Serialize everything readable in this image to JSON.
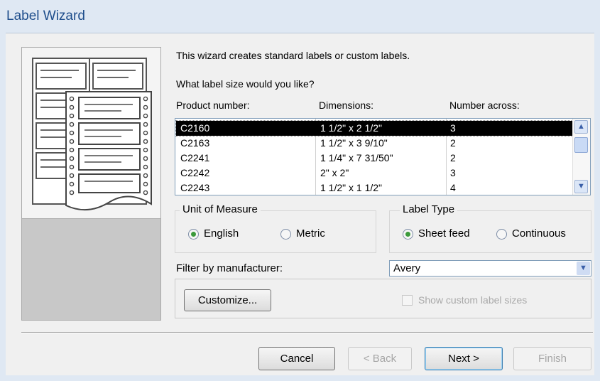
{
  "window": {
    "title": "Label Wizard"
  },
  "intro": {
    "line1": "This wizard creates standard labels or custom labels.",
    "question": "What label size would you like?"
  },
  "columns": [
    "Product number:",
    "Dimensions:",
    "Number across:"
  ],
  "labels": [
    {
      "product": "C2160",
      "dimensions": "1 1/2\" x 2 1/2\"",
      "across": "3",
      "selected": true
    },
    {
      "product": "C2163",
      "dimensions": "1 1/2\" x 3 9/10\"",
      "across": "2",
      "selected": false
    },
    {
      "product": "C2241",
      "dimensions": "1 1/4\" x 7 31/50\"",
      "across": "2",
      "selected": false
    },
    {
      "product": "C2242",
      "dimensions": "2\" x 2\"",
      "across": "3",
      "selected": false
    },
    {
      "product": "C2243",
      "dimensions": "1 1/2\" x 1 1/2\"",
      "across": "4",
      "selected": false
    }
  ],
  "unit_of_measure": {
    "legend": "Unit of Measure",
    "english": "English",
    "metric": "Metric",
    "selected": "English"
  },
  "label_type": {
    "legend": "Label Type",
    "sheet_feed": "Sheet feed",
    "continuous": "Continuous",
    "selected": "Sheet feed"
  },
  "filter": {
    "label": "Filter by manufacturer:",
    "value": "Avery"
  },
  "customize_button": "Customize...",
  "show_custom": {
    "label": "Show custom label sizes",
    "checked": false
  },
  "buttons": {
    "cancel": "Cancel",
    "back": "< Back",
    "next": "Next >",
    "finish": "Finish"
  },
  "icons": {
    "scroll_up": "chevron-up-icon",
    "scroll_down": "chevron-down-icon",
    "dropdown": "chevron-down-icon"
  }
}
